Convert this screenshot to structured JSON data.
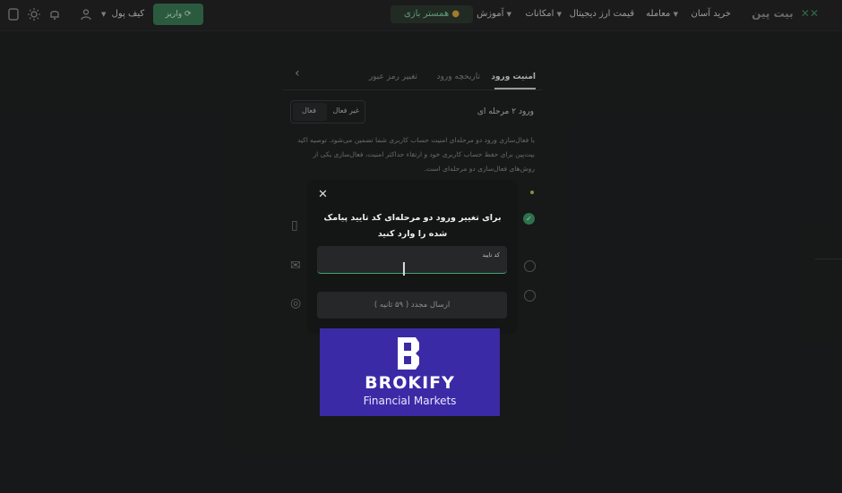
{
  "header": {
    "logo_text": "بیت پین",
    "nav": [
      {
        "label": "خرید آسان"
      },
      {
        "label": "معامله"
      },
      {
        "label": "قیمت ارز دیجیتال"
      },
      {
        "label": "امکانات"
      },
      {
        "label": "آموزش"
      }
    ],
    "mentor_button": "همستر بازی",
    "wallet_label": "کیف پول",
    "green_button_label": "واریز"
  },
  "page": {
    "tabs": [
      {
        "label": "امنیت ورود",
        "active": true
      },
      {
        "label": "تاریخچه ورود",
        "active": false
      },
      {
        "label": "تغییر رمز عبور",
        "active": false
      }
    ],
    "two_fa_label": "ورود ۲ مرحله ای",
    "toggle": {
      "active_label": "فعال",
      "inactive_label": "غیر فعال"
    },
    "description": "با فعال‌سازی ورود دو مرحله‌ای امنیت حساب کاربری شما تضمین می‌شود. توصیه اکید بیت‌پین برای حفظ حساب کاربری خود و ارتقاء حداکثر امنیت، فعال‌سازی یکی از روش‌های فعال‌سازی دو مرحله‌ای است."
  },
  "modal": {
    "title": "برای تغییر ورود دو مرحله‌ای کد تایید پیامک شده را وارد کنید",
    "code_label": "کد تایید",
    "code_value": "",
    "resend_label": "ارسال مجدد ( ۵۹ ثانیه )"
  },
  "ad": {
    "brand": "BROKIFY",
    "tagline": "Financial Markets",
    "color": "#3b2aa6"
  },
  "colors": {
    "accent": "#3fa574",
    "background": "#1f2021"
  }
}
